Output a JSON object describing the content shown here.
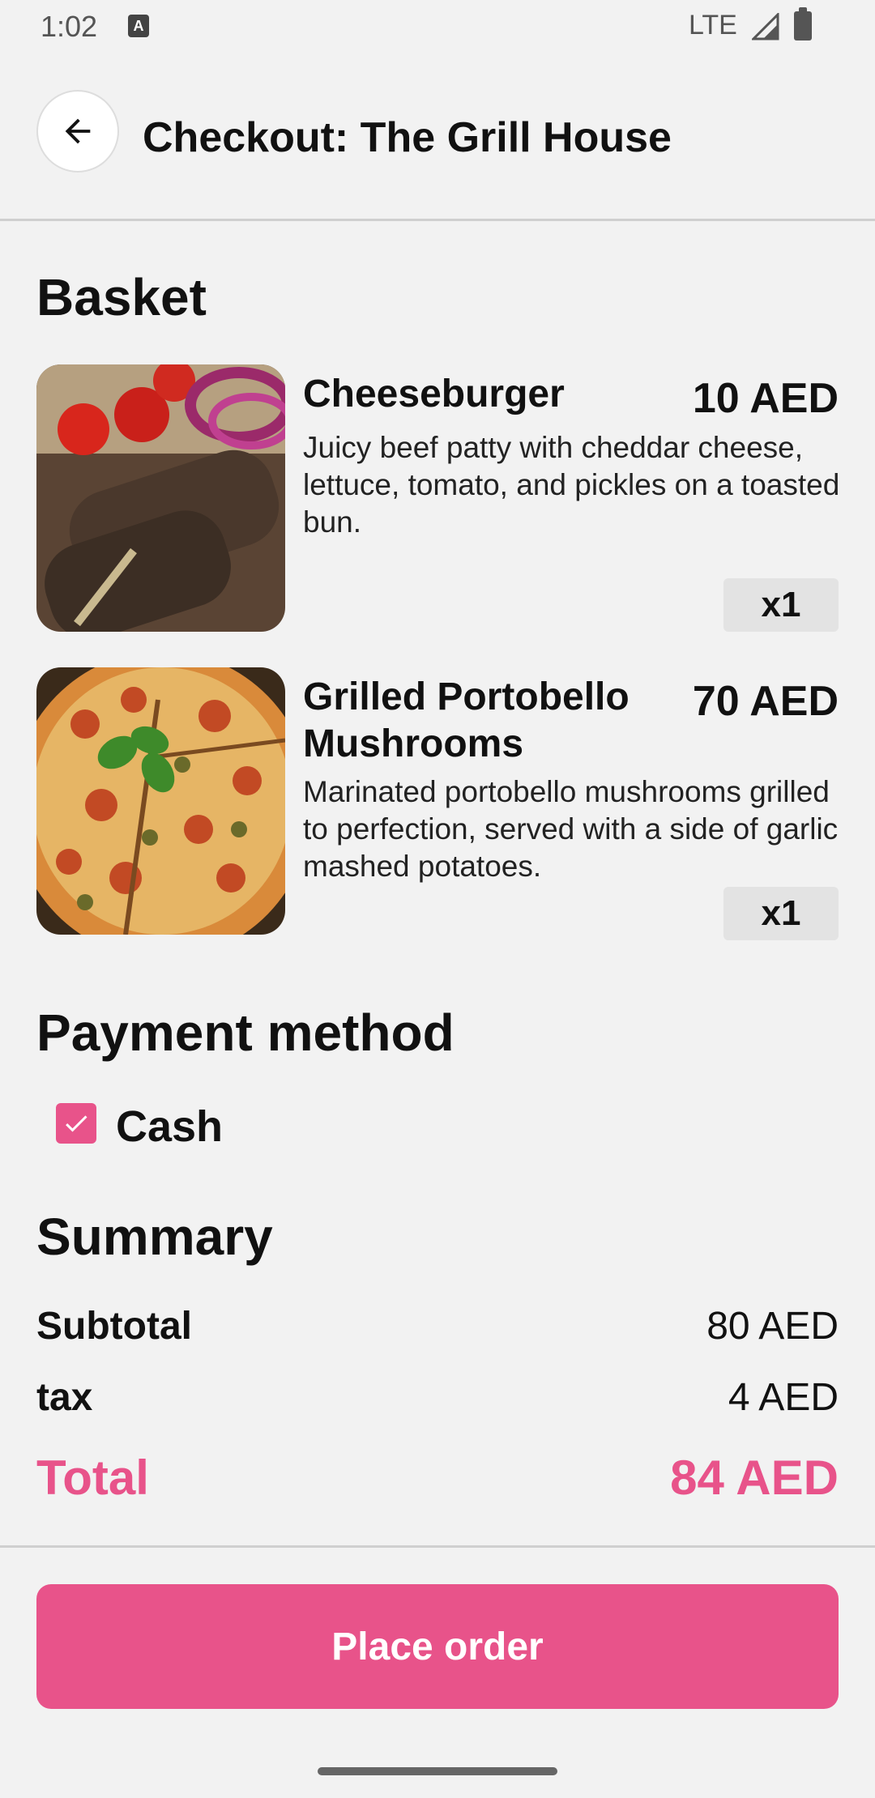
{
  "status_bar": {
    "time": "1:02",
    "network": "LTE"
  },
  "header": {
    "title": "Checkout: The Grill House"
  },
  "basket": {
    "title": "Basket",
    "items": [
      {
        "name": "Cheeseburger",
        "price": "10 AED",
        "description": "Juicy beef patty with cheddar cheese, lettuce, tomato, and pickles on a toasted bun.",
        "quantity": "x1",
        "image": "grilled-kebab-photo"
      },
      {
        "name": "Grilled Portobello Mushrooms",
        "price": "70 AED",
        "description": "Marinated portobello mushrooms grilled to perfection, served with a side of garlic mashed potatoes.",
        "quantity": "x1",
        "image": "pizza-photo"
      }
    ]
  },
  "payment": {
    "title": "Payment method",
    "option_label": "Cash",
    "option_checked": true
  },
  "summary": {
    "title": "Summary",
    "subtotal_label": "Subtotal",
    "subtotal_value": "80 AED",
    "tax_label": "tax",
    "tax_value": "4 AED",
    "total_label": "Total",
    "total_value": "84 AED"
  },
  "actions": {
    "place_order_label": "Place order"
  },
  "colors": {
    "accent": "#e8538a",
    "background": "#f2f2f2"
  }
}
